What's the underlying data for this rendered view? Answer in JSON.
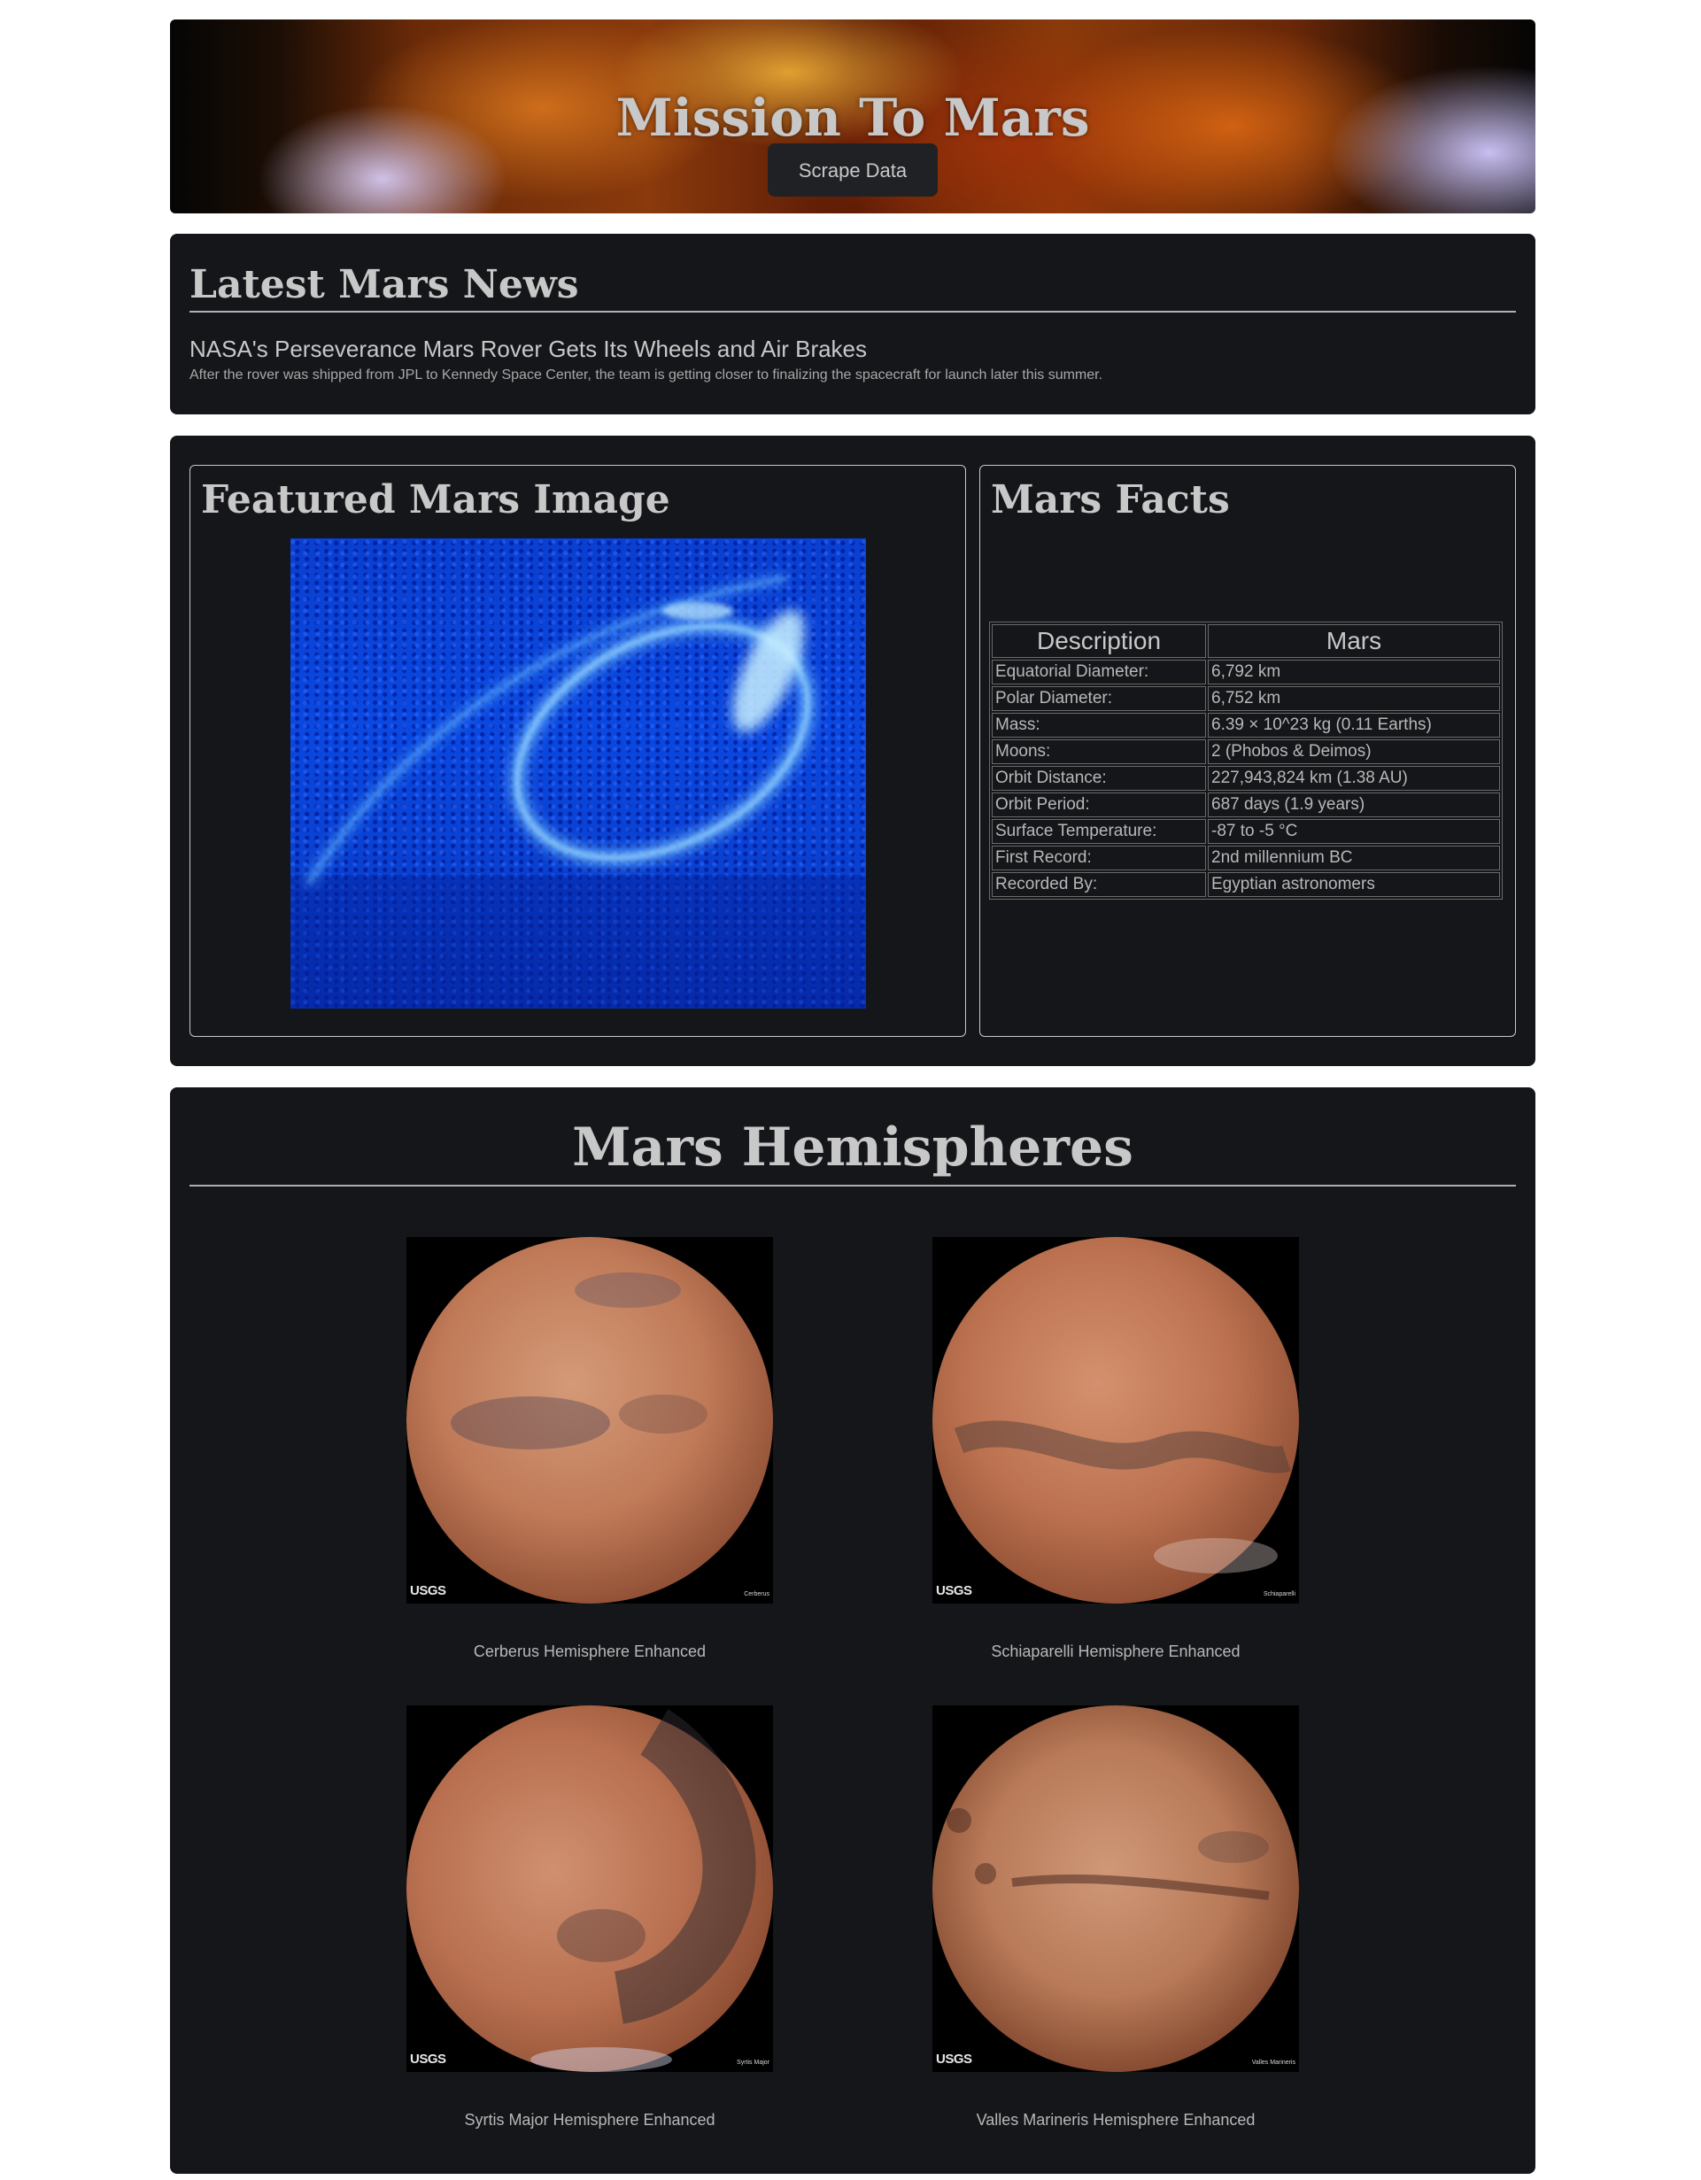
{
  "header": {
    "title": "Mission To Mars",
    "button_label": "Scrape Data"
  },
  "news": {
    "heading": "Latest Mars News",
    "title": "NASA's Perseverance Mars Rover Gets Its Wheels and Air Brakes",
    "paragraph": "After the rover was shipped from JPL to Kennedy Space Center, the team is getting closer to finalizing the spacecraft for launch later this summer."
  },
  "featured": {
    "heading": "Featured Mars Image"
  },
  "facts": {
    "heading": "Mars Facts",
    "columns": [
      "Description",
      "Mars"
    ],
    "rows": [
      [
        "Equatorial Diameter:",
        "6,792 km"
      ],
      [
        "Polar Diameter:",
        "6,752 km"
      ],
      [
        "Mass:",
        "6.39 × 10^23 kg (0.11 Earths)"
      ],
      [
        "Moons:",
        "2 (Phobos & Deimos)"
      ],
      [
        "Orbit Distance:",
        "227,943,824 km (1.38 AU)"
      ],
      [
        "Orbit Period:",
        "687 days (1.9 years)"
      ],
      [
        "Surface Temperature:",
        "-87 to -5 °C"
      ],
      [
        "First Record:",
        "2nd millennium BC"
      ],
      [
        "Recorded By:",
        "Egyptian astronomers"
      ]
    ]
  },
  "hemispheres": {
    "heading": "Mars Hemispheres",
    "logo_text": "USGS",
    "items": [
      {
        "caption": "Cerberus Hemisphere Enhanced",
        "label": "Cerberus"
      },
      {
        "caption": "Schiaparelli Hemisphere Enhanced",
        "label": "Schiaparelli"
      },
      {
        "caption": "Syrtis Major Hemisphere Enhanced",
        "label": "Syrtis Major"
      },
      {
        "caption": "Valles Marineris Hemisphere Enhanced",
        "label": "Valles Marineris"
      }
    ]
  },
  "colors": {
    "page_bg": "#ffffff",
    "panel_bg": "#141619",
    "text": "#c8c8c8",
    "button_bg": "#1f2124"
  }
}
